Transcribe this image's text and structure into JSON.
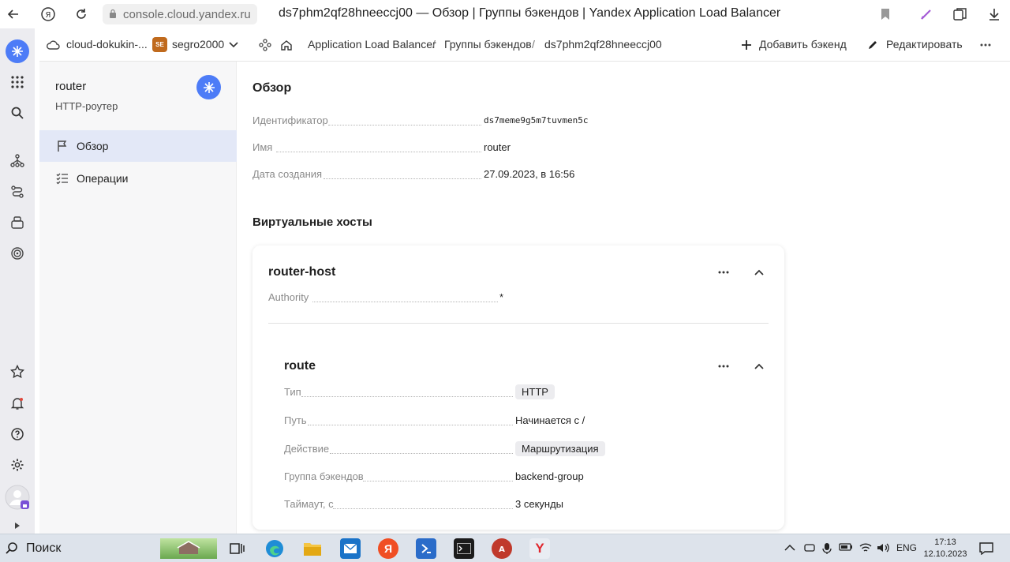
{
  "browser": {
    "url": "console.cloud.yandex.ru",
    "title": "ds7phm2qf28hneeccj00 — Обзор | Группы бэкендов | Yandex Application Load Balancer"
  },
  "header": {
    "cloud": "cloud-dokukin-...",
    "folder_badge": "SE",
    "folder": "segro2000",
    "breadcrumbs": [
      "Application Load Balancer",
      "Группы бэкендов",
      "ds7phm2qf28hneeccj00"
    ],
    "add_backend": "Добавить бэкенд",
    "edit": "Редактировать"
  },
  "sidenav": {
    "title": "router",
    "subtitle": "HTTP-роутер",
    "items": [
      {
        "label": "Обзор",
        "active": true
      },
      {
        "label": "Операции",
        "active": false
      }
    ]
  },
  "overview": {
    "title": "Обзор",
    "fields": [
      {
        "key": "Идентификатор",
        "value": "ds7meme9g5m7tuvmen5c"
      },
      {
        "key": "Имя",
        "value": "router"
      },
      {
        "key": "Дата создания",
        "value": "27.09.2023, в 16:56"
      }
    ]
  },
  "vhosts": {
    "title": "Виртуальные хосты",
    "host": {
      "name": "router-host",
      "authority_key": "Authority",
      "authority_value": "*"
    },
    "route": {
      "name": "route",
      "fields": [
        {
          "key": "Тип",
          "value": "HTTP"
        },
        {
          "key": "Путь",
          "value": "Начинается с /"
        },
        {
          "key": "Действие",
          "value": "Маршрутизация"
        },
        {
          "key": "Группа бэкендов",
          "value": "backend-group"
        },
        {
          "key": "Таймаут, с",
          "value": "3 секунды"
        }
      ]
    }
  },
  "taskbar": {
    "search": "Поиск",
    "lang": "ENG",
    "time": "17:13",
    "date": "12.10.2023"
  },
  "colors": {
    "accent": "#4d7cf7",
    "link": "#3a6fd8",
    "nav_active": "#e3e8f7"
  }
}
